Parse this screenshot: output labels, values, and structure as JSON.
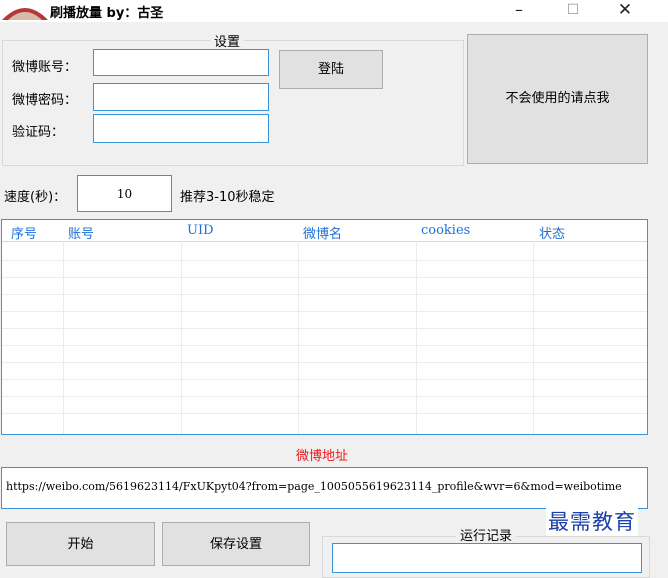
{
  "window": {
    "title": "刷播放量 by：古圣",
    "minimize_glyph": "–",
    "maximize_glyph": "☐",
    "close_glyph": "✕"
  },
  "settings": {
    "legend": "设置",
    "account_label": "微博账号：",
    "account_value": "",
    "password_label": "微博密码：",
    "password_value": "",
    "captcha_label": "验证码：",
    "captcha_value": "",
    "login_button": "登陆",
    "help_button": "不会使用的请点我"
  },
  "speed": {
    "label": "速度(秒)：",
    "value": "10",
    "hint": "推荐3-10秒稳定"
  },
  "table": {
    "columns": [
      "序号",
      "账号",
      "UID",
      "微博名",
      "cookies",
      "状态"
    ],
    "rows": []
  },
  "weibo_address": {
    "label": "微博地址",
    "url": "https://weibo.com/5619623114/FxUKpyt04?from=page_1005055619623114_profile&wvr=6&mod=weibotime"
  },
  "actions": {
    "start_button": "开始",
    "save_button": "保存设置",
    "log_legend": "运行记录"
  },
  "watermark": "最需教育",
  "colors": {
    "accent_border": "#3c93d6",
    "header_text": "#1e6fd9",
    "red_label": "#e8181c",
    "watermark": "#1c3fa8"
  }
}
